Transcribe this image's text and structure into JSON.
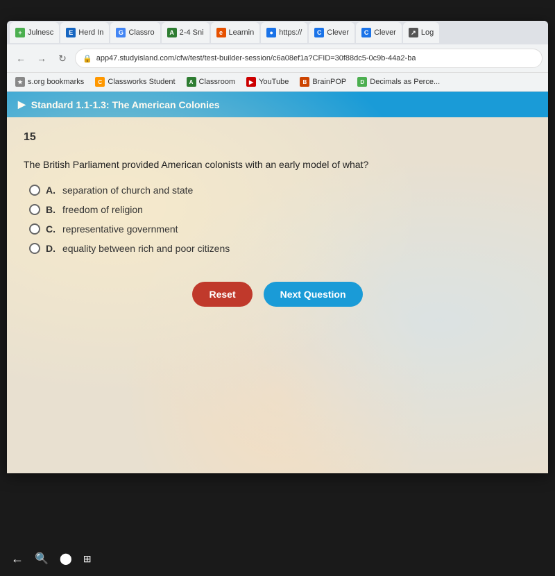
{
  "browser": {
    "tabs": [
      {
        "id": "tab1",
        "label": "Julnesc",
        "icon_color": "#4CAF50",
        "icon_text": "+"
      },
      {
        "id": "tab2",
        "label": "Herd In",
        "icon_color": "#1565C0",
        "icon_text": "E"
      },
      {
        "id": "tab3",
        "label": "Classro",
        "icon_color": "#4285F4",
        "icon_text": "G"
      },
      {
        "id": "tab4",
        "label": "2-4 Sni",
        "icon_color": "#2e7d32",
        "icon_text": "A"
      },
      {
        "id": "tab5",
        "label": "Learnin",
        "icon_color": "#e65100",
        "icon_text": "e"
      },
      {
        "id": "tab6",
        "label": "https://",
        "icon_color": "#1a73e8",
        "icon_text": "●"
      },
      {
        "id": "tab7",
        "label": "Clever",
        "icon_color": "#1a73e8",
        "icon_text": "C"
      },
      {
        "id": "tab8",
        "label": "Clever",
        "icon_color": "#1a73e8",
        "icon_text": "C"
      },
      {
        "id": "tab9",
        "label": "Log",
        "icon_color": "#555",
        "icon_text": "↗"
      }
    ],
    "address": "app47.studyisland.com/cfw/test/test-builder-session/c6a08ef1a?CFID=30f88dc5-0c9b-44a2-ba",
    "bookmarks": [
      {
        "label": "s.org bookmarks",
        "icon_color": "#888",
        "icon_text": "★"
      },
      {
        "label": "Classworks Student",
        "icon_color": "#ff9800",
        "icon_text": "C"
      },
      {
        "label": "Classroom",
        "icon_color": "#2e7d32",
        "icon_text": "A"
      },
      {
        "label": "YouTube",
        "icon_color": "#cc0000",
        "icon_text": "▶"
      },
      {
        "label": "BrainPOP",
        "icon_color": "#cc4400",
        "icon_text": "B"
      },
      {
        "label": "Decimals as Perce...",
        "icon_color": "#4CAF50",
        "icon_text": "D"
      }
    ]
  },
  "page": {
    "standard_label": "Standard 1.1-1.3: The American Colonies",
    "question_number": "15",
    "question_text": "The British Parliament provided American colonists with an early model of what?",
    "options": [
      {
        "letter": "A.",
        "text": "separation of church and state"
      },
      {
        "letter": "B.",
        "text": "freedom of religion"
      },
      {
        "letter": "C.",
        "text": "representative government"
      },
      {
        "letter": "D.",
        "text": "equality between rich and poor citizens"
      }
    ],
    "buttons": {
      "reset_label": "Reset",
      "next_label": "Next Question"
    }
  }
}
